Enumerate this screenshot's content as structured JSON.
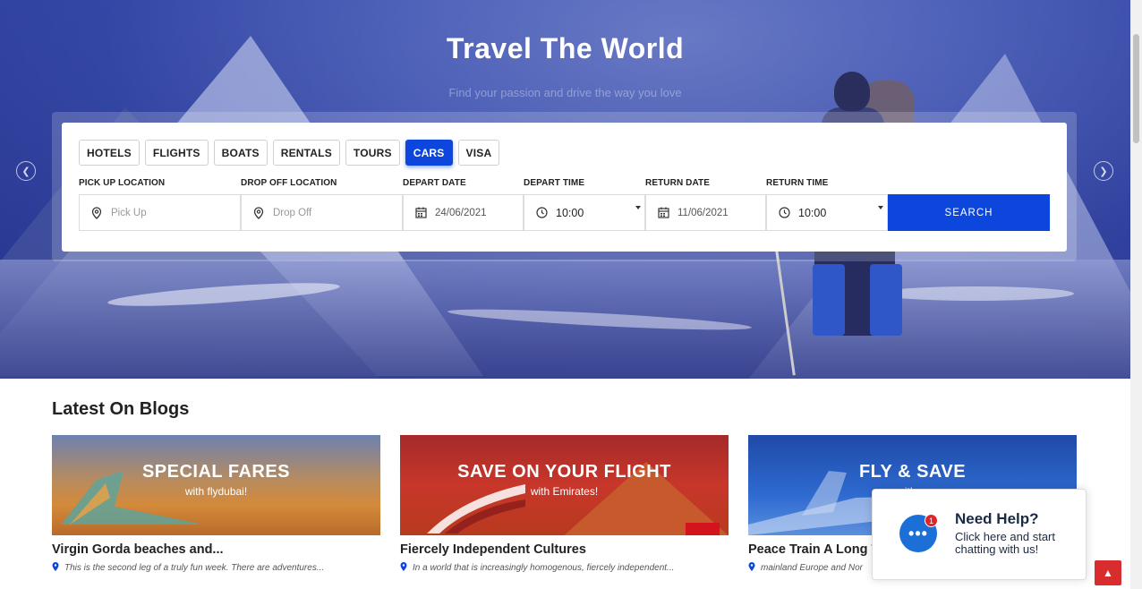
{
  "hero": {
    "title": "Travel The World",
    "subtitle": "Find your passion and drive the way you love"
  },
  "search": {
    "tabs": [
      {
        "label": "HOTELS",
        "active": false
      },
      {
        "label": "FLIGHTS",
        "active": false
      },
      {
        "label": "BOATS",
        "active": false
      },
      {
        "label": "RENTALS",
        "active": false
      },
      {
        "label": "TOURS",
        "active": false
      },
      {
        "label": "CARS",
        "active": true
      },
      {
        "label": "VISA",
        "active": false
      }
    ],
    "pickup": {
      "label": "PICK UP LOCATION",
      "placeholder": "Pick Up",
      "icon": "map-marker-icon"
    },
    "dropoff": {
      "label": "DROP OFF LOCATION",
      "placeholder": "Drop Off",
      "icon": "map-marker-icon"
    },
    "depart_date": {
      "label": "DEPART DATE",
      "value": "24/06/2021",
      "icon": "calendar-icon"
    },
    "depart_time": {
      "label": "DEPART TIME",
      "value": "10:00",
      "icon": "clock-icon"
    },
    "return_date": {
      "label": "RETURN DATE",
      "value": "11/06/2021",
      "icon": "calendar-icon"
    },
    "return_time": {
      "label": "RETURN TIME",
      "value": "10:00",
      "icon": "clock-icon"
    },
    "search_label": "SEARCH"
  },
  "blogs": {
    "title": "Latest On Blogs",
    "cards": [
      {
        "banner_title": "SPECIAL FARES",
        "banner_sub": "with flydubai!",
        "title": "Virgin Gorda beaches and...",
        "desc": "This is the second leg of a truly fun week. There are adventures..."
      },
      {
        "banner_title": "SAVE ON YOUR FLIGHT",
        "banner_sub": "with Emirates!",
        "title": "Fiercely Independent Cultures",
        "desc": "In a world that is increasingly homogenous, fiercely independent..."
      },
      {
        "banner_title": "FLY & SAVE",
        "banner_sub": "with ...",
        "title": "Peace Train A Long T",
        "desc": "mainland Europe and Nor"
      }
    ]
  },
  "chat": {
    "title": "Need Help?",
    "subtitle": "Click here and start chatting with us!",
    "badge": "1",
    "bubble": "•••"
  },
  "colors": {
    "accent": "#0c46dd",
    "chat_blue": "#1b6fd6",
    "badge_red": "#e0242c",
    "to_top_red": "#d92d2d"
  }
}
